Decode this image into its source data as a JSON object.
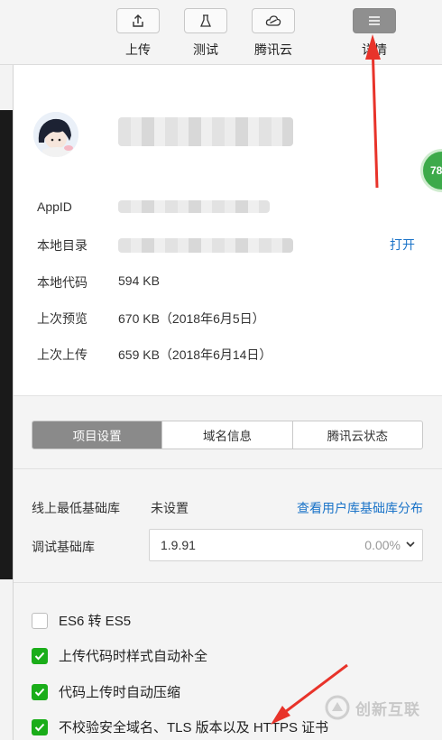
{
  "toolbar": {
    "upload": "上传",
    "test": "测试",
    "tencent_cloud": "腾讯云",
    "details": "详情"
  },
  "project": {
    "appid_label": "AppID",
    "dir_label": "本地目录",
    "open_link": "打开",
    "code_label": "本地代码",
    "code_value": "594 KB",
    "preview_label": "上次预览",
    "preview_value": "670 KB（2018年6月5日）",
    "upload_label": "上次上传",
    "upload_value": "659 KB（2018年6月14日）"
  },
  "tabs": [
    "项目设置",
    "域名信息",
    "腾讯云状态"
  ],
  "library": {
    "min_label": "线上最低基础库",
    "min_value": "未设置",
    "distribution_link": "查看用户库基础库分布",
    "debug_label": "调试基础库",
    "debug_version": "1.9.91",
    "debug_percent": "0.00%"
  },
  "options": [
    {
      "label": "ES6 转 ES5",
      "checked": false
    },
    {
      "label": "上传代码时样式自动补全",
      "checked": true
    },
    {
      "label": "代码上传时自动压缩",
      "checked": true
    },
    {
      "label": "不校验安全域名、TLS 版本以及 HTTPS 证书",
      "checked": true
    }
  ],
  "overlay": {
    "badge_text": "78",
    "watermark_text": "创新互联"
  },
  "colors": {
    "accent_link": "#1a73c8",
    "check_green": "#1aad19",
    "tab_active": "#8a8a8a",
    "annotation_red": "#e8332a"
  }
}
